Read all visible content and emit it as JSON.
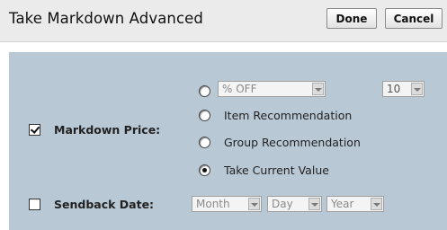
{
  "header": {
    "title": "Take Markdown Advanced",
    "done_label": "Done",
    "cancel_label": "Cancel"
  },
  "markdown_price": {
    "label": "Markdown Price:",
    "checked": true,
    "options": [
      {
        "type": "select",
        "selected": false,
        "value": "% OFF"
      },
      {
        "type": "text",
        "selected": false,
        "label": "Item Recommendation"
      },
      {
        "type": "text",
        "selected": false,
        "label": "Group Recommendation"
      },
      {
        "type": "text",
        "selected": true,
        "label": "Take Current Value"
      }
    ],
    "amount_value": "10"
  },
  "sendback_date": {
    "label": "Sendback Date:",
    "checked": false,
    "month": "Month",
    "day": "Day",
    "year": "Year"
  }
}
